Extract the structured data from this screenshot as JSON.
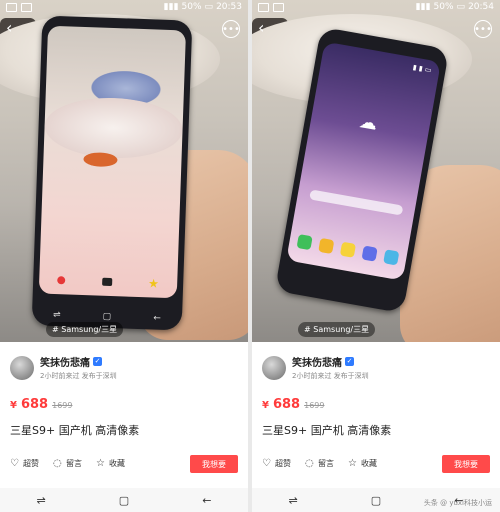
{
  "panels": [
    {
      "status": {
        "battery": "50%",
        "time": "20:53"
      },
      "tag": "# Samsung/三星",
      "seller": {
        "name": "笑抹伤悲痛",
        "meta": "2小时前来过 发布于深圳"
      },
      "price": {
        "currency": "¥",
        "value": "688",
        "old": "1699"
      },
      "title": "三星S9+ 国产机 高清像素",
      "actions": {
        "like": "超赞",
        "comment": "留言",
        "favorite": "收藏",
        "want": "我想要"
      }
    },
    {
      "status": {
        "battery": "50%",
        "time": "20:54"
      },
      "tag": "# Samsung/三星",
      "seller": {
        "name": "笑抹伤悲痛",
        "meta": "2小时前来过 发布于深圳"
      },
      "price": {
        "currency": "¥",
        "value": "688",
        "old": "1699"
      },
      "title": "三星S9+ 国产机 高清像素",
      "actions": {
        "like": "超赞",
        "comment": "留言",
        "favorite": "收藏",
        "want": "我想要"
      }
    }
  ],
  "watermark": "头条 @ yuxi科技小运",
  "icons": {
    "back": "chevron-left-icon",
    "more": "more-icon",
    "like": "heart-icon",
    "comment": "chat-icon",
    "favorite": "star-icon",
    "recent": "recent-icon",
    "home": "square-icon",
    "nav_back": "arrow-left-icon"
  },
  "colors": {
    "accent": "#ff4a4a",
    "price": "#ff3b3b",
    "verified": "#2f7bff"
  }
}
